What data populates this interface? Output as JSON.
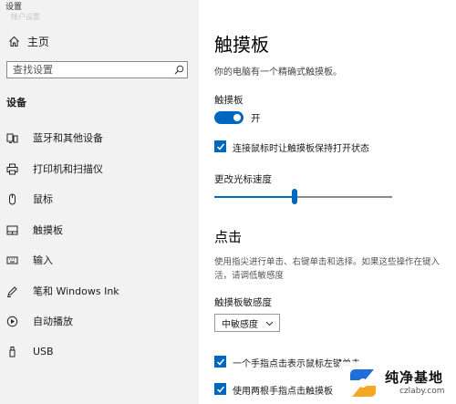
{
  "window": {
    "title": "设置",
    "faded_text": "帐户设置"
  },
  "sidebar": {
    "home_label": "主页",
    "search_placeholder": "查找设置",
    "section_title": "设备",
    "items": [
      {
        "label": "蓝牙和其他设备",
        "icon": "devices-icon"
      },
      {
        "label": "打印机和扫描仪",
        "icon": "printer-icon"
      },
      {
        "label": "鼠标",
        "icon": "mouse-icon"
      },
      {
        "label": "触摸板",
        "icon": "touchpad-icon"
      },
      {
        "label": "输入",
        "icon": "keyboard-icon"
      },
      {
        "label": "笔和 Windows Ink",
        "icon": "pen-icon"
      },
      {
        "label": "自动播放",
        "icon": "autoplay-icon"
      },
      {
        "label": "USB",
        "icon": "usb-icon"
      }
    ]
  },
  "main": {
    "title": "触摸板",
    "subtitle": "你的电脑有一个精确式触摸板。",
    "toggle_label": "触摸板",
    "toggle_state": "开",
    "keep_on_label": "连接鼠标时让触摸板保持打开状态",
    "cursor_speed_label": "更改光标速度",
    "cursor_speed_level": 0.45,
    "taps_heading": "点击",
    "taps_description_line1": "使用指尖进行单击、右键单击和选择。如果这些操作在键入",
    "taps_description_line2": "活，请调低敏感度",
    "sensitivity_label": "触摸板敏感度",
    "sensitivity_value": "中敏感度",
    "checkbox_single_tap": "一个手指点击表示鼠标左键单击",
    "checkbox_two_finger_tap": "使用两根手指点击触摸板"
  },
  "watermark": {
    "name": "纯净基地",
    "url": "czlaby.com"
  },
  "colors": {
    "accent": "#0067c0",
    "sidebar_bg": "#f2f2f2"
  }
}
